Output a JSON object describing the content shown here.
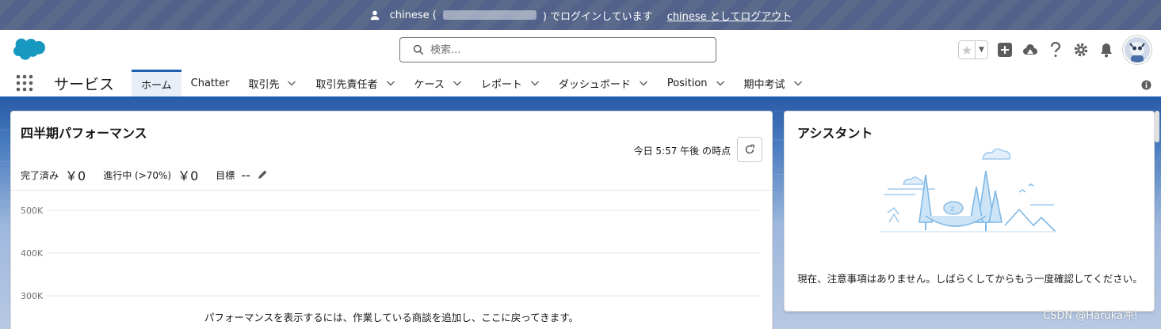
{
  "impersonation": {
    "user": "chinese (",
    "suffix": ") でログインしています",
    "logout": "chinese としてログアウト"
  },
  "search": {
    "placeholder": "検索..."
  },
  "nav": {
    "app_name": "サービス",
    "tabs": [
      {
        "label": "ホーム",
        "active": true,
        "dropdown": false
      },
      {
        "label": "Chatter",
        "dropdown": false
      },
      {
        "label": "取引先",
        "dropdown": true
      },
      {
        "label": "取引先責任者",
        "dropdown": true
      },
      {
        "label": "ケース",
        "dropdown": true
      },
      {
        "label": "レポート",
        "dropdown": true
      },
      {
        "label": "ダッシュボード",
        "dropdown": true
      },
      {
        "label": "Position",
        "dropdown": true
      },
      {
        "label": "期中考试",
        "dropdown": true
      }
    ]
  },
  "performance": {
    "title": "四半期パフォーマンス",
    "as_of": "今日 5:57 午後 の時点",
    "completed_label": "完了済み",
    "completed_value": "￥0",
    "inprogress_label": "進行中 (>70%)",
    "inprogress_value": "￥0",
    "goal_label": "目標",
    "goal_value": "--",
    "empty_message": "パフォーマンスを表示するには、作業している商談を追加し、ここに戻ってきます。"
  },
  "chart_data": {
    "type": "line",
    "y_ticks": [
      "500K",
      "400K",
      "300K"
    ],
    "series": []
  },
  "assistant": {
    "title": "アシスタント",
    "message": "現在、注意事項はありません。しばらくしてからもう一度確認してください。"
  },
  "watermark": "CSDN @Haruka冲！",
  "colors": {
    "brand": "#1b5fb3",
    "header_bar": "#5a6a8a"
  }
}
